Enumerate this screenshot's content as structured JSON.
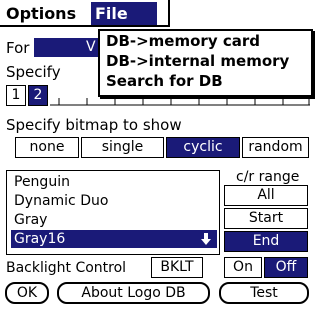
{
  "menubar": {
    "menus": [
      "Options",
      "File"
    ],
    "active_menu": "File"
  },
  "file_menu": {
    "items": [
      "DB->memory card",
      "DB->internal memory",
      "Search for DB"
    ]
  },
  "form": {
    "for_label": "For",
    "for_value": "V",
    "specify_label": "Specify",
    "page_tabs": [
      "1",
      "2"
    ],
    "bitmap_label": "Specify bitmap to show",
    "bitmap_options": [
      "none",
      "single",
      "cyclic",
      "random"
    ],
    "bitmap_selected": "cyclic",
    "list": [
      "Penguin",
      "Dynamic Duo",
      "Gray",
      "Gray16"
    ],
    "list_selected": "Gray16",
    "scroll_arrow": "down-arrow-icon",
    "range_label": "c/r range",
    "range_options": [
      "All",
      "Start",
      "End"
    ],
    "range_selected": "End",
    "backlight_label": "Backlight Control",
    "backlight_button": "BKLT",
    "backlight_on": "On",
    "backlight_off": "Off",
    "backlight_selected": "Off"
  },
  "buttons": {
    "ok": "OK",
    "about": "About Logo DB",
    "test": "Test"
  },
  "colors": {
    "selection": "#1a1a78",
    "background": "#ffffff"
  }
}
